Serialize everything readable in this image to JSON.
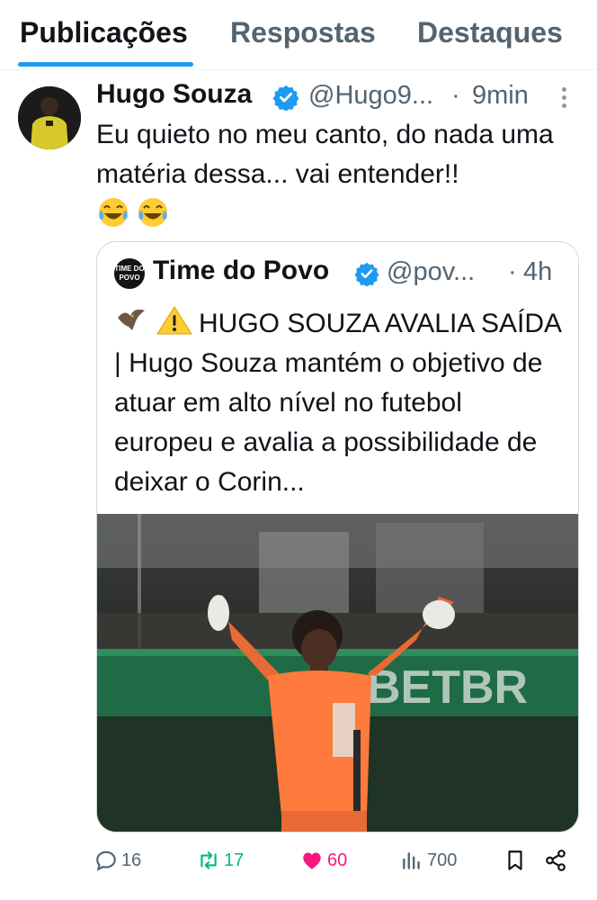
{
  "tabs": [
    {
      "label": "Publicações",
      "active": true
    },
    {
      "label": "Respostas",
      "active": false
    },
    {
      "label": "Destaques",
      "active": false
    }
  ],
  "tweet": {
    "author_name": "Hugo Souza",
    "handle": "@Hugo9...",
    "separator": "·",
    "time": "9min",
    "text": "Eu quieto no meu canto, do nada uma matéria dessa... vai entender!!",
    "emojis": [
      "face-with-tears-of-joy",
      "face-with-tears-of-joy"
    ],
    "quote": {
      "logo_text": "TIME DO POVO",
      "author_name": "Time do Povo",
      "handle": "@pov...",
      "separator": "·",
      "time": "4h",
      "leading_icons": [
        "eagle-icon",
        "warning-icon"
      ],
      "text": "HUGO SOUZA AVALIA SAÍDA | Hugo Souza mantém o objetivo de atuar em alto nível no futebol europeu e avalia a possibilidade de deixar o Corin...",
      "image_ad_text": "BETBR"
    },
    "actions": {
      "replies": "16",
      "retweets": "17",
      "likes": "60",
      "views": "700"
    }
  },
  "colors": {
    "accent": "#1d9bf0",
    "retweet": "#00ba7c",
    "like": "#f91880",
    "muted": "#536471"
  }
}
